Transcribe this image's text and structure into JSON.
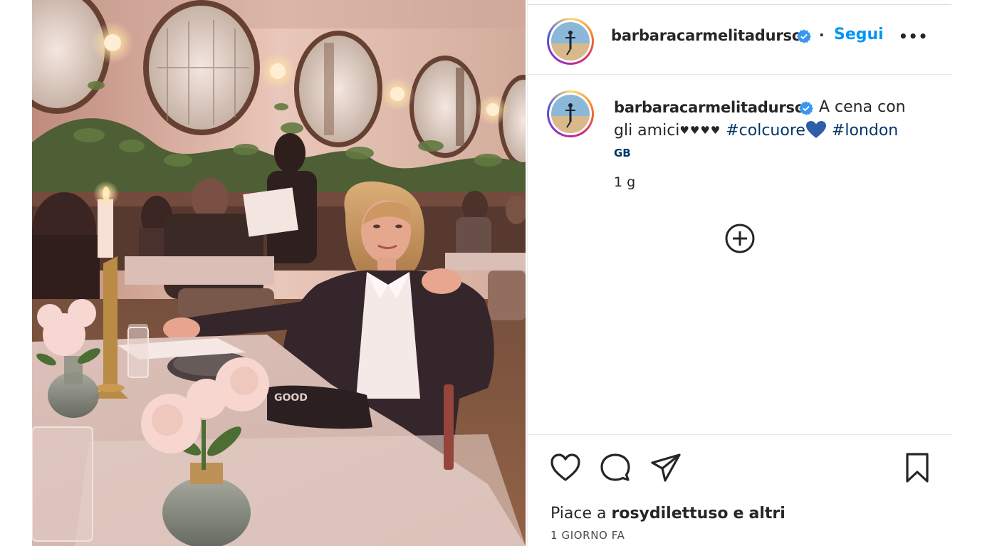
{
  "post": {
    "author": {
      "username": "barbaracarmelitadurso",
      "verified": true
    },
    "header": {
      "separator": "·",
      "follow_label": "Segui",
      "more_label": "•••"
    },
    "caption": {
      "text_line1": "A cena con",
      "text_line2": "gli amici",
      "hearts": "♥♥♥♥",
      "hashtag1": "#colcuore",
      "hashtag2": "#london",
      "location_tag": "GB",
      "time_ago": "1 g"
    },
    "actions": {
      "like": "heart-icon",
      "comment": "comment-icon",
      "share": "share-icon",
      "save": "bookmark-icon",
      "add_comment": "plus-circle-icon"
    },
    "likes": {
      "prefix": "Piace a",
      "user": "rosydilettuso",
      "and": "e",
      "others": "altri"
    },
    "date": "1 GIORNO FA"
  },
  "colors": {
    "follow_blue": "#0095f6",
    "verified_blue": "#3897f0",
    "hashtag_blue": "#00376b",
    "text": "#262626",
    "divider": "#e6e6e6"
  },
  "photo": {
    "embossed_text": "GOOD"
  }
}
